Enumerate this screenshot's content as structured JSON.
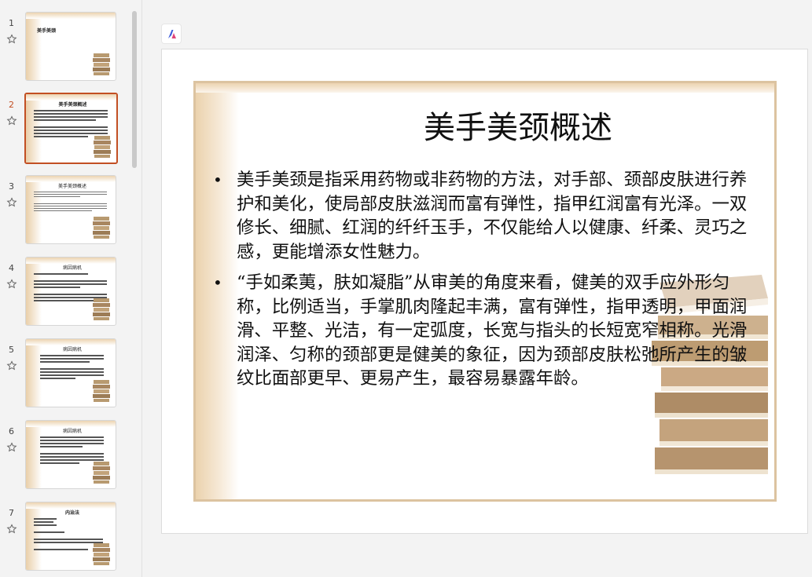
{
  "slides": [
    {
      "number": "1",
      "title": "美手美颈"
    },
    {
      "number": "2",
      "title": "美手美颈概述"
    },
    {
      "number": "3",
      "title": "美手美颈概述"
    },
    {
      "number": "4",
      "title": "病因病机"
    },
    {
      "number": "5",
      "title": "病因病机"
    },
    {
      "number": "6",
      "title": "病因病机"
    },
    {
      "number": "7",
      "title": "内治法"
    }
  ],
  "active_slide": "2",
  "current_slide": {
    "title": "美手美颈概述",
    "bullets": [
      "美手美颈是指采用药物或非药物的方法，对手部、颈部皮肤进行养护和美化，使局部皮肤滋润而富有弹性，指甲红润富有光泽。一双修长、细腻、红润的纤纤玉手，不仅能给人以健康、纤柔、灵巧之感，更能增添女性魅力。",
      "“手如柔荑，肤如凝脂”从审美的角度来看，健美的双手应外形匀称，比例适当，手掌肌肉隆起丰满，富有弹性，指甲透明，甲面润滑、平整、光洁，有一定弧度，长宽与指头的长短宽窄相称。光滑润泽、匀称的颈部更是健美的象征，因为颈部皮肤松弛所产生的皱纹比面部更早、更易产生，最容易暴露年龄。"
    ]
  },
  "colors": {
    "accent": "#c24f23",
    "frame": "#dcc3a0",
    "gradient": "#ebd2ad"
  },
  "icons": {
    "star": "star-icon",
    "addin": "copilot-icon"
  }
}
